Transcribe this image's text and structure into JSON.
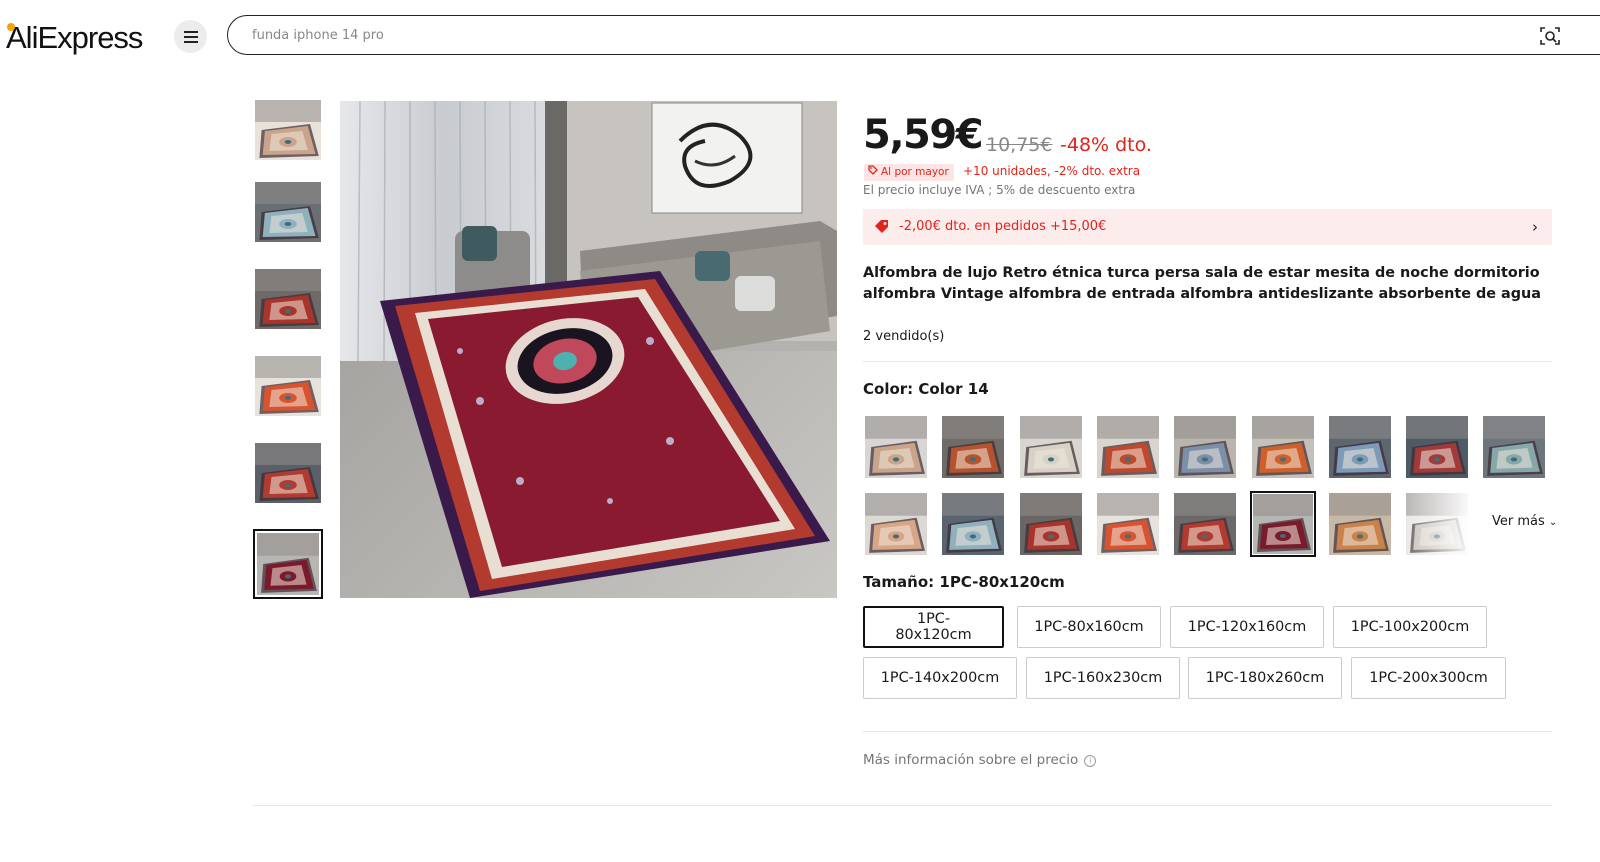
{
  "header": {
    "logo": "AliExpress",
    "search_placeholder": "funda iphone 14 pro",
    "icons": {
      "menu": "hamburger-menu-icon",
      "camera": "image-search-icon"
    }
  },
  "product": {
    "price": "5,59€",
    "original_price": "10,75€",
    "discount": "-48% dto.",
    "wholesale_badge": "Al por mayor",
    "wholesale_text": "+10 unidades, -2% dto. extra",
    "vat_note": "El precio incluye IVA ; 5% de descuento extra",
    "coupon_text": "-2,00€ dto. en pedidos +15,00€",
    "title": "Alfombra de lujo Retro étnica turca persa sala de estar mesita de noche dormitorio alfombra Vintage alfombra de entrada alfombra antideslizante absorbente de agua",
    "sold": "2 vendido(s)",
    "color_label": "Color: Color 14",
    "ver_mas": "Ver más",
    "size_label": "Tamaño: 1PC-80x120cm",
    "sizes": [
      "1PC-80x120cm",
      "1PC-80x160cm",
      "1PC-120x160cm",
      "1PC-100x200cm",
      "1PC-140x200cm",
      "1PC-160x230cm",
      "1PC-180x260cm",
      "1PC-200x300cm"
    ],
    "selected_size": "1PC-80x120cm",
    "price_info": "Más información sobre el precio"
  },
  "colors": {
    "accent_red": "#e2231a",
    "coupon_bg": "#fdecec",
    "rug_variants": [
      "#c9a48a",
      "#b5532e",
      "#d8d2c6",
      "#c0492d",
      "#7b8fa8",
      "#d0602a",
      "#7d9bb8",
      "#a23a3a",
      "#86a8a8",
      "#d9a587",
      "#8fb0bd",
      "#a8342c",
      "#d8532e",
      "#b23a2e",
      "#7a1a2a",
      "#c9834a",
      "#c7c2bb"
    ]
  }
}
